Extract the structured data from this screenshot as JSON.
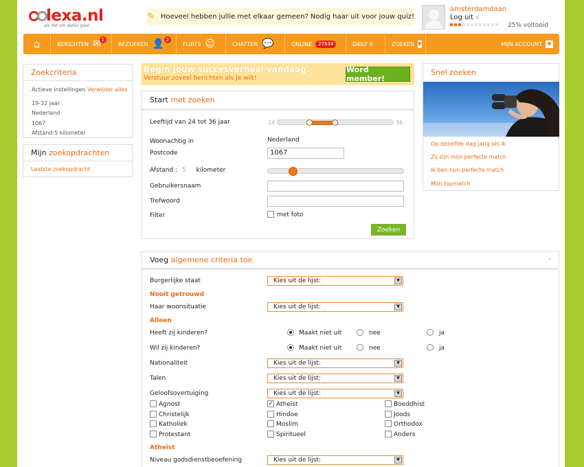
{
  "logo": {
    "text": "lexa.nl",
    "tagline": "als het om daten gaat"
  },
  "notice": {
    "text": "Hoeveel hebben jullie met elkaar gemeen? Nodig haar uit voor jouw quiz!"
  },
  "profile": {
    "username": "amsterdamdaan",
    "logout": "Log uit",
    "close": "x",
    "progress_fraction": 0.25,
    "progress_label": "25% voltooid"
  },
  "nav": {
    "berichten": "BERICHTEN",
    "berichten_badge": "1",
    "bezoeken": "BEZOEKEN",
    "bezoeken_badge": "2",
    "flirts": "FLIRTS",
    "chatten": "CHATTEN",
    "online": "ONLINE",
    "online_count": "27534",
    "daily6": "DAILY 6",
    "zoeken": "ZOEKEN",
    "account": "MIJN ACCOUNT"
  },
  "zoekcriteria": {
    "title": "Zoekcriteria",
    "actieve": "Actieve instellingen",
    "verwijder": "Verwijder alles",
    "items": [
      "19-32 jaar",
      "Nederland",
      "1067",
      "Afstand:5 kilometer"
    ]
  },
  "opdrachten": {
    "title_a": "Mijn ",
    "title_b": "zoekopdrachten",
    "link": "Laatste zoekopdracht"
  },
  "banner": {
    "title": "Begin jouw succesverhaal vandaag.",
    "subtitle": "Verstuur zoveel berichten als je wilt!",
    "button": "Word member!"
  },
  "search": {
    "title_a": "Start ",
    "title_b": "met zoeken",
    "age_label": "Leeftijd van 24 tot 36 jaar",
    "age_min": "24",
    "age_max": "36",
    "woonachtig_label": "Woonachtig in",
    "woonachtig_value": "Nederland",
    "postcode_label": "Postcode",
    "postcode_value": "1067",
    "afstand_label": "Afstand :",
    "afstand_value": "5",
    "afstand_unit": "kilometer",
    "gebruikersnaam_label": "Gebruikersnaam",
    "trefwoord_label": "Trefwoord",
    "filter_label": "Filter",
    "met_foto": "met foto",
    "button": "Zoeken"
  },
  "snel": {
    "title": "Snel zoeken",
    "links": [
      "Op dezelfde dag jarig als ik",
      "Zij zijn mijn perfecte match",
      "Ik ben hun perfecte match",
      "Mijn topmatch"
    ]
  },
  "criteria": {
    "title_a": "Voeg ",
    "title_b": "algemene criteria toe",
    "collapse": "-",
    "select_placeholder": "Kies uit de lijst:",
    "burgerlijke": "Burgerlijke staat",
    "burgerlijke_value": "Nooit getrouwd",
    "woonsituatie": "Haar woonsituatie",
    "woonsituatie_value": "Alleen",
    "heeft_kinderen": "Heeft zij kinderen?",
    "wil_kinderen": "Wil zij kinderen?",
    "maakt_niet_uit": "Maakt niet uit",
    "nee": "nee",
    "ja": "ja",
    "nationaliteit": "Nationaliteit",
    "talen": "Talen",
    "geloof": "Geloofsovertuiging",
    "geloof_options": [
      [
        "Agnost",
        "Atheïst",
        "Boeddhist"
      ],
      [
        "Christelijk",
        "Hindoe",
        "Joods"
      ],
      [
        "Katholiek",
        "Moslim",
        "Orthodox"
      ],
      [
        "Protestant",
        "Spiritueel",
        "Anders"
      ]
    ],
    "geloof_value": "Atheïst",
    "niveau": "Niveau godsdienstbeoefening"
  }
}
